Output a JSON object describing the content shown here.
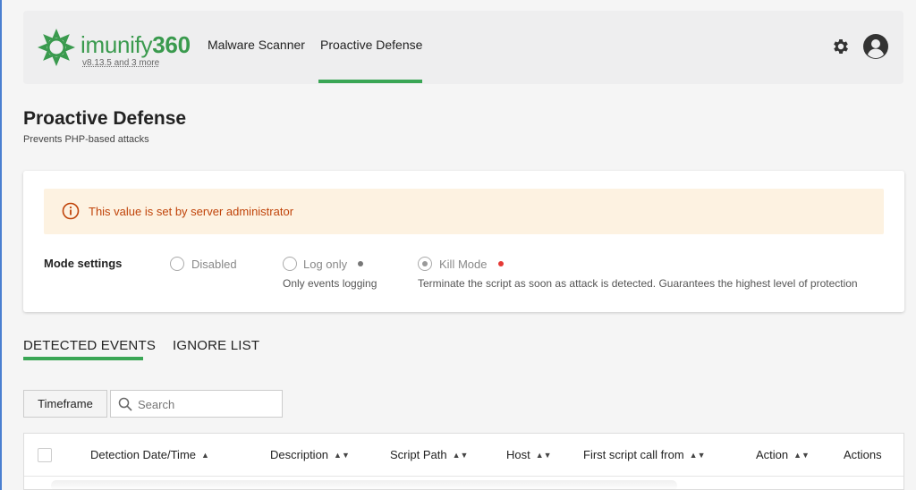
{
  "header": {
    "logo_text_light": "imunify",
    "logo_text_bold": "360",
    "version": "v8.13.5 and 3 more",
    "nav": [
      {
        "label": "Malware Scanner"
      },
      {
        "label": "Proactive Defense",
        "active": true
      }
    ],
    "icons": [
      "imunify-logo-icon",
      "gear-icon",
      "user-avatar-icon"
    ]
  },
  "page": {
    "title": "Proactive Defense",
    "subtitle": "Prevents PHP-based attacks"
  },
  "settings": {
    "alert_text": "This value is set by server administrator",
    "mode_label": "Mode settings",
    "modes": [
      {
        "label": "Disabled",
        "description": "",
        "selected": false,
        "dot_color": ""
      },
      {
        "label": "Log only",
        "description": "Only events logging",
        "selected": false,
        "dot_color": "#777777"
      },
      {
        "label": "Kill Mode",
        "description": "Terminate the script as soon as attack is detected. Guarantees the highest level of protection",
        "selected": true,
        "dot_color": "#e53935"
      }
    ]
  },
  "tabs": [
    {
      "label": "DETECTED EVENTS",
      "active": true
    },
    {
      "label": "IGNORE LIST",
      "active": false
    }
  ],
  "toolbar": {
    "timeframe_label": "Timeframe",
    "search_placeholder": "Search"
  },
  "table": {
    "columns": [
      {
        "label": "Detection Date/Time",
        "sort": "▲"
      },
      {
        "label": "Description",
        "sort": "▲▼"
      },
      {
        "label": "Script Path",
        "sort": "▲▼"
      },
      {
        "label": "Host",
        "sort": "▲▼"
      },
      {
        "label": "First script call from",
        "sort": "▲▼"
      },
      {
        "label": "Action",
        "sort": "▲▼"
      },
      {
        "label": "Actions",
        "sort": ""
      }
    ]
  },
  "colors": {
    "accent": "#3aa655",
    "alert_bg": "#fdf2e1",
    "alert_text": "#c0440a"
  }
}
